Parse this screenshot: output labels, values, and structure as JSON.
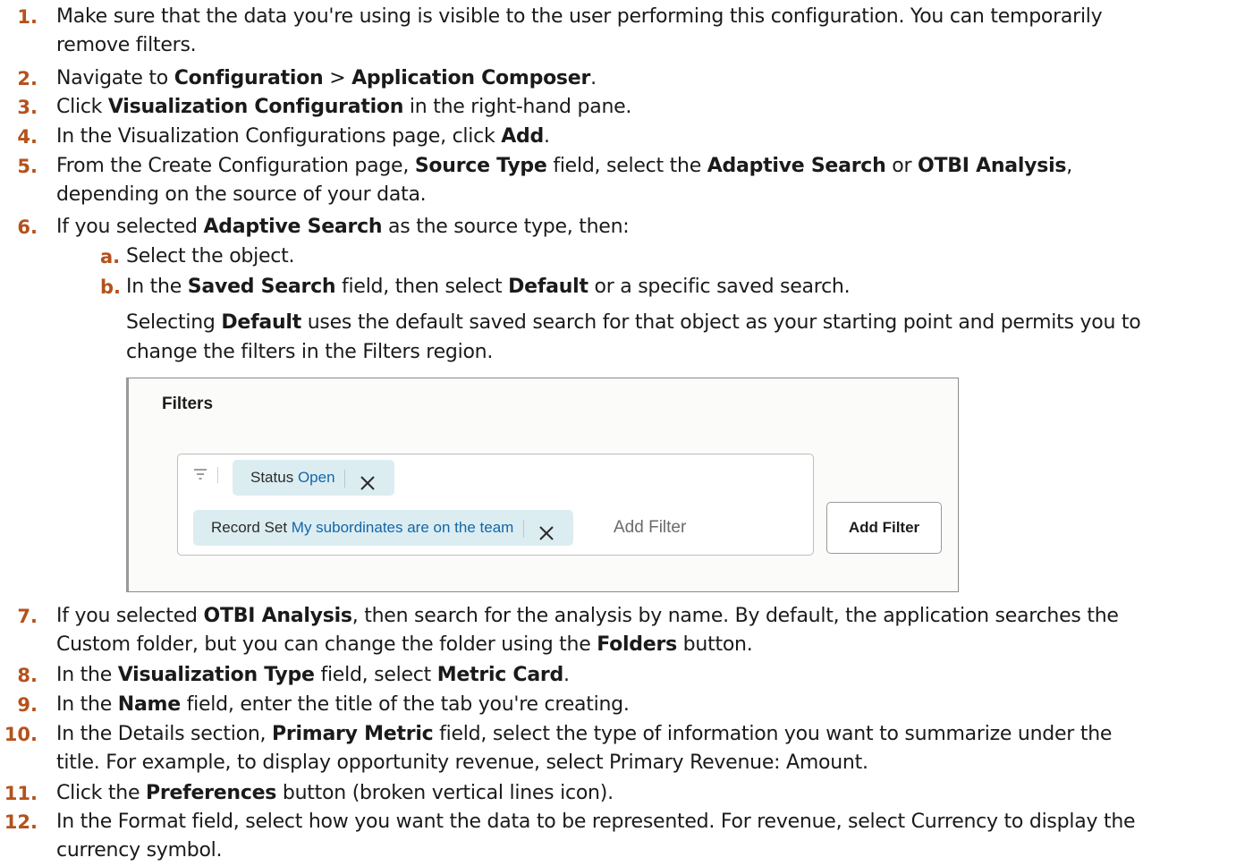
{
  "steps": [
    {
      "num": "1.",
      "lines": [
        [
          {
            "t": "Make sure that the data you're using is visible to the user performing this configuration. You can temporarily"
          }
        ],
        [
          {
            "t": "remove filters."
          }
        ]
      ]
    },
    {
      "num": "2.",
      "lines": [
        [
          {
            "t": "Navigate to "
          },
          {
            "t": "Configuration",
            "b": true
          },
          {
            "t": " >  "
          },
          {
            "t": "Application Composer",
            "b": true
          },
          {
            "t": "."
          }
        ]
      ]
    },
    {
      "num": "3.",
      "lines": [
        [
          {
            "t": "Click "
          },
          {
            "t": "Visualization Configuration",
            "b": true
          },
          {
            "t": " in the right-hand pane."
          }
        ]
      ]
    },
    {
      "num": "4.",
      "lines": [
        [
          {
            "t": "In the Visualization Configurations page, click "
          },
          {
            "t": "Add",
            "b": true
          },
          {
            "t": "."
          }
        ]
      ]
    },
    {
      "num": "5.",
      "lines": [
        [
          {
            "t": "From the Create Configuration page, "
          },
          {
            "t": "Source Type",
            "b": true
          },
          {
            "t": " field, select the "
          },
          {
            "t": "Adaptive Search",
            "b": true
          },
          {
            "t": " or "
          },
          {
            "t": "OTBI Analysis",
            "b": true
          },
          {
            "t": ","
          }
        ],
        [
          {
            "t": "depending on the source of your data."
          }
        ]
      ]
    },
    {
      "num": "6.",
      "lines": [
        [
          {
            "t": "If you selected "
          },
          {
            "t": "Adaptive Search",
            "b": true
          },
          {
            "t": " as the source type, then:"
          }
        ]
      ]
    },
    {
      "num": "7.",
      "lines": [
        [
          {
            "t": "If you selected "
          },
          {
            "t": "OTBI Analysis",
            "b": true
          },
          {
            "t": ", then search for the analysis by name. By default, the application searches the"
          }
        ],
        [
          {
            "t": "Custom folder, but you can change the folder using the "
          },
          {
            "t": "Folders",
            "b": true
          },
          {
            "t": " button."
          }
        ]
      ]
    },
    {
      "num": "8.",
      "lines": [
        [
          {
            "t": "In the "
          },
          {
            "t": "Visualization Type",
            "b": true
          },
          {
            "t": " field, select "
          },
          {
            "t": "Metric Card",
            "b": true
          },
          {
            "t": "."
          }
        ]
      ]
    },
    {
      "num": "9.",
      "lines": [
        [
          {
            "t": "In the "
          },
          {
            "t": "Name",
            "b": true
          },
          {
            "t": " field, enter the title of the tab you're creating."
          }
        ]
      ]
    },
    {
      "num": "10.",
      "lines": [
        [
          {
            "t": "In the Details section, "
          },
          {
            "t": "Primary Metric",
            "b": true
          },
          {
            "t": " field, select the type of information you want to summarize under the"
          }
        ],
        [
          {
            "t": "title. For example, to display opportunity revenue, select Primary Revenue: Amount."
          }
        ]
      ]
    },
    {
      "num": "11.",
      "lines": [
        [
          {
            "t": "Click the "
          },
          {
            "t": "Preferences",
            "b": true
          },
          {
            "t": " button (broken vertical lines icon)."
          }
        ]
      ]
    },
    {
      "num": "12.",
      "lines": [
        [
          {
            "t": "In the Format field, select how you want the data to be represented. For revenue, select Currency to display the"
          }
        ],
        [
          {
            "t": "currency symbol."
          }
        ]
      ]
    }
  ],
  "substeps": [
    {
      "letter": "a.",
      "lines": [
        [
          {
            "t": "Select the object."
          }
        ]
      ]
    },
    {
      "letter": "b.",
      "lines": [
        [
          {
            "t": "In the "
          },
          {
            "t": "Saved Search",
            "b": true
          },
          {
            "t": " field, then select "
          },
          {
            "t": "Default",
            "b": true
          },
          {
            "t": " or a specific saved search."
          }
        ]
      ]
    }
  ],
  "note_lines": [
    [
      {
        "t": "Selecting "
      },
      {
        "t": "Default",
        "b": true
      },
      {
        "t": " uses the default saved search for that object as your starting point and permits you to"
      }
    ],
    [
      {
        "t": "change the filters in the Filters region."
      }
    ]
  ],
  "filters_panel": {
    "title": "Filters",
    "chip_status": {
      "label": "Status",
      "value": "Open"
    },
    "chip_recordset": {
      "label": "Record Set",
      "value": "My subordinates are on the team"
    },
    "add_filter_placeholder": "Add Filter",
    "add_filter_button": "Add Filter"
  },
  "colors": {
    "step_number": "#b4521c",
    "chip_bg": "#dcedf2",
    "chip_value": "#1466a8"
  }
}
